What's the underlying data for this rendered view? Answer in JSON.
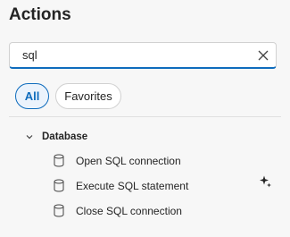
{
  "panel": {
    "title": "Actions"
  },
  "search": {
    "value": "sql",
    "placeholder": ""
  },
  "filters": [
    {
      "label": "All",
      "selected": true
    },
    {
      "label": "Favorites",
      "selected": false
    }
  ],
  "group": {
    "label": "Database",
    "expanded": true,
    "items": [
      {
        "label": "Open SQL connection",
        "icon": "database-icon"
      },
      {
        "label": "Execute SQL statement",
        "icon": "database-icon"
      },
      {
        "label": "Close SQL connection",
        "icon": "database-icon"
      }
    ]
  },
  "colors": {
    "accent": "#0f6cbd",
    "background": "#f7f7f7",
    "text": "#242424"
  }
}
